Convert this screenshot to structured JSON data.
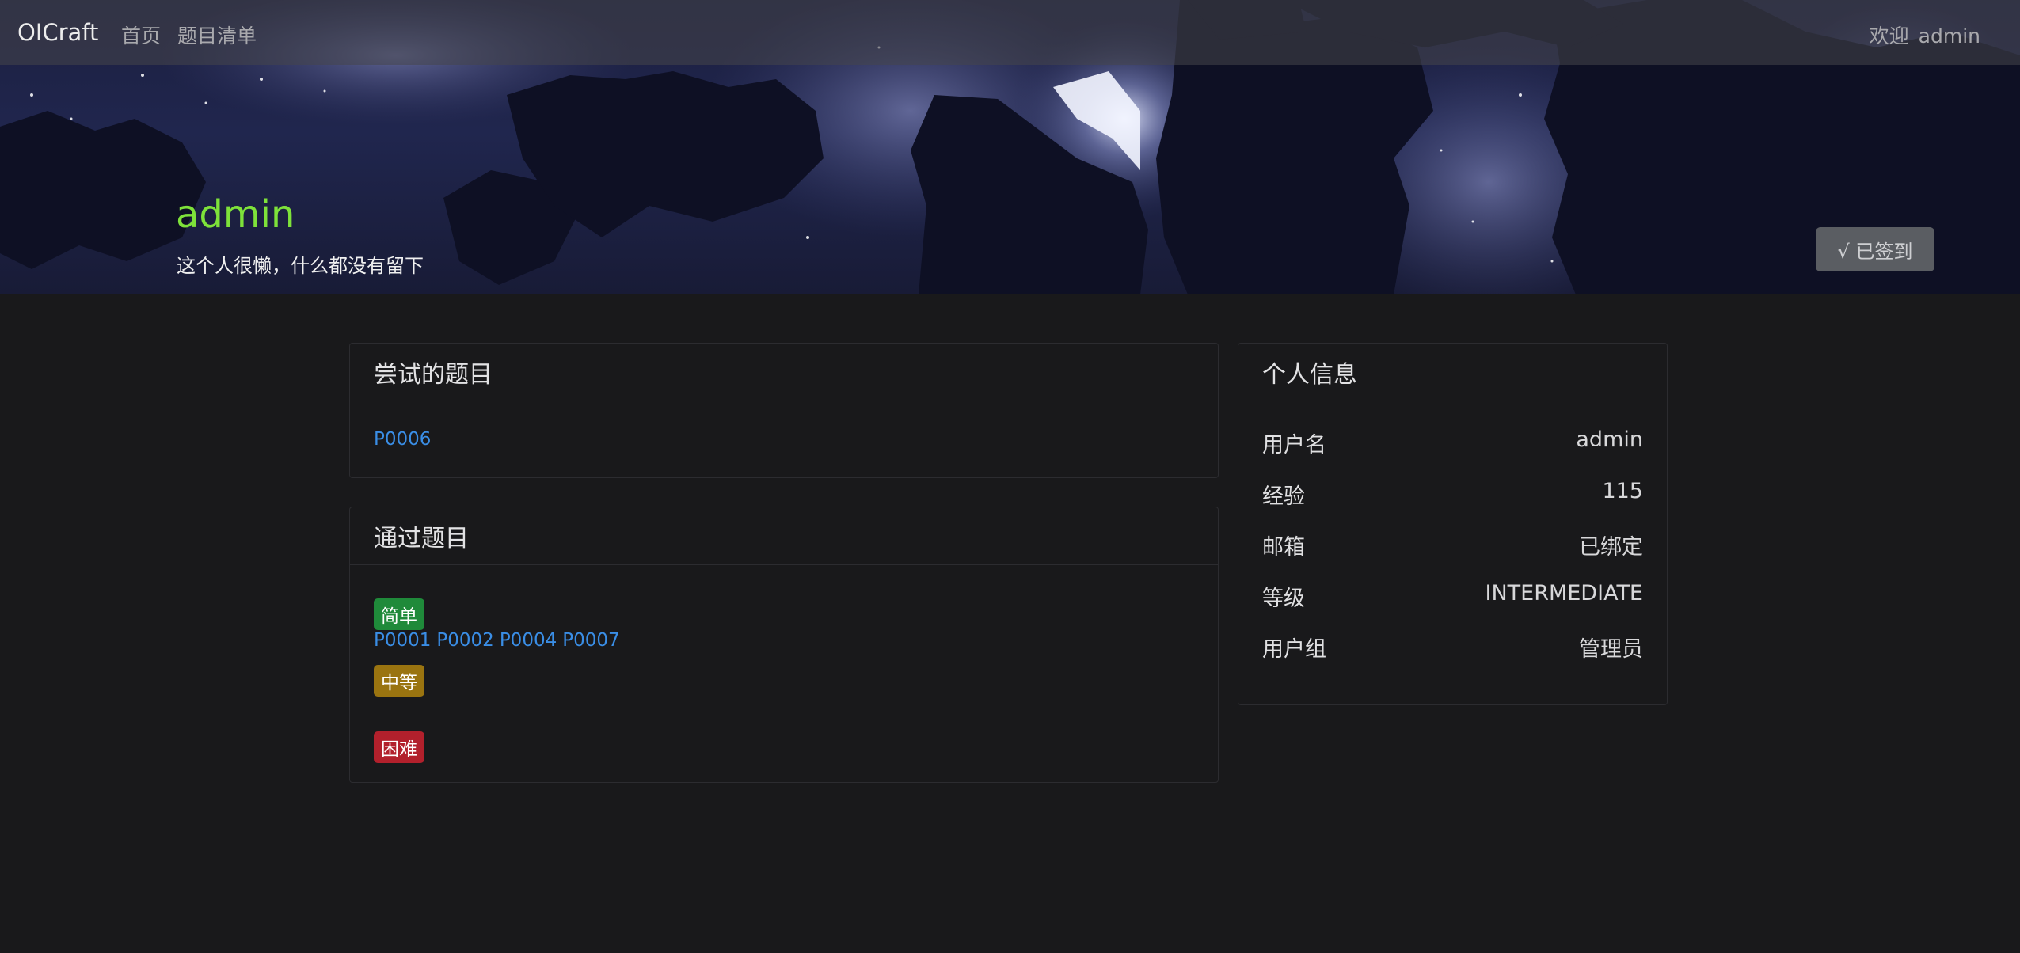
{
  "nav": {
    "brand": "OICraft",
    "links": [
      "首页",
      "题目清单"
    ],
    "welcome_label": "欢迎",
    "username": "admin"
  },
  "profile": {
    "name": "admin",
    "bio": "这个人很懒，什么都没有留下",
    "signin_label": "√ 已签到"
  },
  "attempted": {
    "title": "尝试的题目",
    "problems": [
      "P0006"
    ]
  },
  "passed": {
    "title": "通过题目",
    "groups": [
      {
        "label": "简单",
        "color": "#1f8a3a",
        "problems": [
          "P0001",
          "P0002",
          "P0004",
          "P0007"
        ]
      },
      {
        "label": "中等",
        "color": "#9a7410",
        "problems": []
      },
      {
        "label": "困难",
        "color": "#b2202c",
        "problems": []
      }
    ]
  },
  "info": {
    "title": "个人信息",
    "rows": [
      {
        "label": "用户名",
        "value": "admin"
      },
      {
        "label": "经验",
        "value": "115"
      },
      {
        "label": "邮箱",
        "value": "已绑定"
      },
      {
        "label": "等级",
        "value": "INTERMEDIATE"
      },
      {
        "label": "用户组",
        "value": "管理员"
      }
    ]
  },
  "colors": {
    "accent_link": "#3a8ee6",
    "profile_name": "#7ee23a",
    "background": "#19191b"
  }
}
